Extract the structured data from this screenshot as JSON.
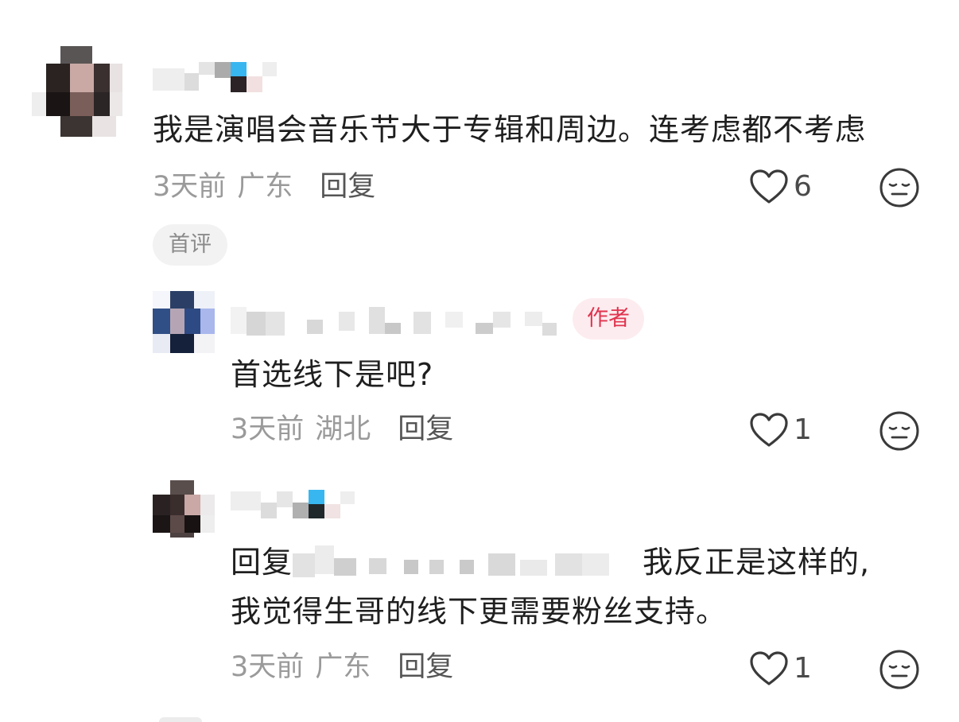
{
  "colors": {
    "author_tag_bg": "#fdecef",
    "author_tag_text": "#e0344f",
    "meta_text": "#9a9a9a",
    "reply_text": "#555555"
  },
  "comments": [
    {
      "content": "我是演唱会音乐节大于专辑和周边。连考虑都不考虑",
      "time": "3天前",
      "location": "广东",
      "reply_label": "回复",
      "likes": "6",
      "badge": "首评"
    },
    {
      "content": "首选线下是吧?",
      "time": "3天前",
      "location": "湖北",
      "reply_label": "回复",
      "likes": "1",
      "author_tag": "作者"
    },
    {
      "content_prefix": "回复",
      "content_suffix": "我反正是这样的,",
      "content_line2": "我觉得生哥的线下更需要粉丝支持。",
      "time": "3天前",
      "location": "广东",
      "reply_label": "回复",
      "likes": "1"
    }
  ]
}
